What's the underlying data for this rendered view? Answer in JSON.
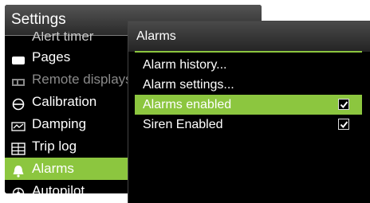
{
  "settings": {
    "title": "Settings",
    "items": [
      {
        "label": "Alert timer",
        "icon": "timer-icon"
      },
      {
        "label": "Pages",
        "icon": "pages-icon"
      },
      {
        "label": "Remote displays",
        "icon": "remote-displays-icon"
      },
      {
        "label": "Calibration",
        "icon": "calibration-icon"
      },
      {
        "label": "Damping",
        "icon": "damping-icon"
      },
      {
        "label": "Trip log",
        "icon": "trip-log-icon"
      },
      {
        "label": "Alarms",
        "icon": "bell-icon"
      },
      {
        "label": "Autopilot",
        "icon": "autopilot-icon"
      }
    ]
  },
  "alarms": {
    "title": "Alarms",
    "items": [
      {
        "label": "Alarm history..."
      },
      {
        "label": "Alarm settings..."
      },
      {
        "label": "Alarms enabled",
        "checked": true
      },
      {
        "label": "Siren Enabled",
        "checked": true
      }
    ]
  },
  "colors": {
    "accent": "#8cc63f",
    "background": "#000000",
    "text": "#ffffff"
  }
}
